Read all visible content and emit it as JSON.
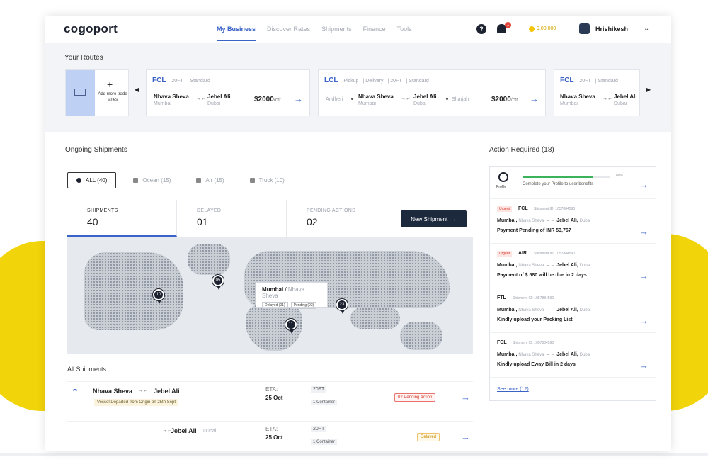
{
  "nav": {
    "logo": "cogoport",
    "links": [
      "My Business",
      "Discover Rates",
      "Shipments",
      "Finance",
      "Tools"
    ],
    "help": "?",
    "notifications_count": "1",
    "wallet": "9,00,000",
    "user": "Hrishikesh"
  },
  "routes": {
    "title": "Your Routes",
    "add_label": "Add more trade lanes",
    "cards": [
      {
        "mode": "FCL",
        "tags": [
          "20FT",
          "Standard"
        ],
        "origin": "Nhava Sheva",
        "origin_sub": "Mumbai",
        "dest": "Jebel Ali",
        "dest_sub": "Dubai",
        "price": "$2000",
        "unit": "/ctr"
      },
      {
        "mode": "LCL",
        "tags": [
          "Pickup",
          "Delivery",
          "20FT",
          "Standard"
        ],
        "pickup": "Andheri",
        "origin": "Nhava Sheva",
        "origin_sub": "Mumbai",
        "dest": "Jebel Ali",
        "dest_sub": "Dubai",
        "drop": "Sharjah",
        "price": "$2000",
        "unit": "/ctr"
      },
      {
        "mode": "FCL",
        "tags": [
          "20FT",
          "Standard"
        ],
        "origin": "Nhava Sheva",
        "origin_sub": "Mumbai",
        "dest": "Jebel Ali",
        "dest_sub": "Dubai"
      }
    ]
  },
  "ongoing": {
    "title": "Ongoing Shipments",
    "filters": [
      {
        "label": "ALL (40)",
        "active": true
      },
      {
        "label": "Ocean (15)"
      },
      {
        "label": "Air (15)"
      },
      {
        "label": "Truck (10)"
      }
    ],
    "stats": [
      {
        "label": "SHIPMENTS",
        "value": "40"
      },
      {
        "label": "DELAYED",
        "value": "01"
      },
      {
        "label": "PENDING ACTIONS",
        "value": "02"
      }
    ],
    "new_shipment": "New Shipment",
    "map": {
      "pins": [
        "10",
        "05",
        "11",
        "23"
      ],
      "tooltip": {
        "city": "Mumbai",
        "port": "Nhava Sheva",
        "delayed": "Delayed (01)",
        "pending": "Pending (02)"
      }
    }
  },
  "all_shipments": {
    "title": "All Shipments",
    "rows": [
      {
        "origin": "Nhava Sheva",
        "dest": "Jebel Ali",
        "note": "Vessel Departed from Origin on 25th Sept",
        "eta_label": "ETA:",
        "eta": "25 Oct",
        "container": "20FT",
        "count": "1 Container",
        "badge": "02 Pending Action"
      },
      {
        "dest": "Jebel Ali",
        "dest_sub": "Dubai",
        "eta_label": "ETA:",
        "eta": "25 Oct",
        "container": "20FT",
        "count": "1 Container",
        "badge": "Delayed"
      }
    ]
  },
  "actions": {
    "title": "Action Required (18)",
    "profile": {
      "label": "Profile",
      "text": "Complete your Profile to user benefits",
      "pct_text": "80%",
      "progress": 0.8
    },
    "items": [
      {
        "urgent": "Urgent",
        "mode": "FCL",
        "sid": "Shipment ID: 1057884590",
        "o": "Mumbai,",
        "os": "Nhava Sheva",
        "d": "Jebel Ali,",
        "ds": "Dubai",
        "msg": "Payment Pending of INR 53,767"
      },
      {
        "urgent": "Urgent",
        "mode": "AIR",
        "sid": "Shipment ID: 1057884590",
        "o": "Mumbai,",
        "os": "Nhava Sheva",
        "d": "Jebel Ali,",
        "ds": "Dubai",
        "msg": "Payment of $ 580 will be due in 2 days"
      },
      {
        "mode": "FTL",
        "sid": "Shipment ID: 1057884590",
        "o": "Mumbai,",
        "os": "Nhava Sheva",
        "d": "Jebel Ali,",
        "ds": "Dubai",
        "msg": "Kindly upload your Packing List"
      },
      {
        "mode": "FCL",
        "sid": "Shipment ID: 1057884590",
        "o": "Mumbai,",
        "os": "Nhava Sheva",
        "d": "Jebel Ali,",
        "ds": "Dubai",
        "msg": "Kindly upload Eway Bill in 2 days"
      }
    ],
    "see_more": "See more (12)"
  }
}
